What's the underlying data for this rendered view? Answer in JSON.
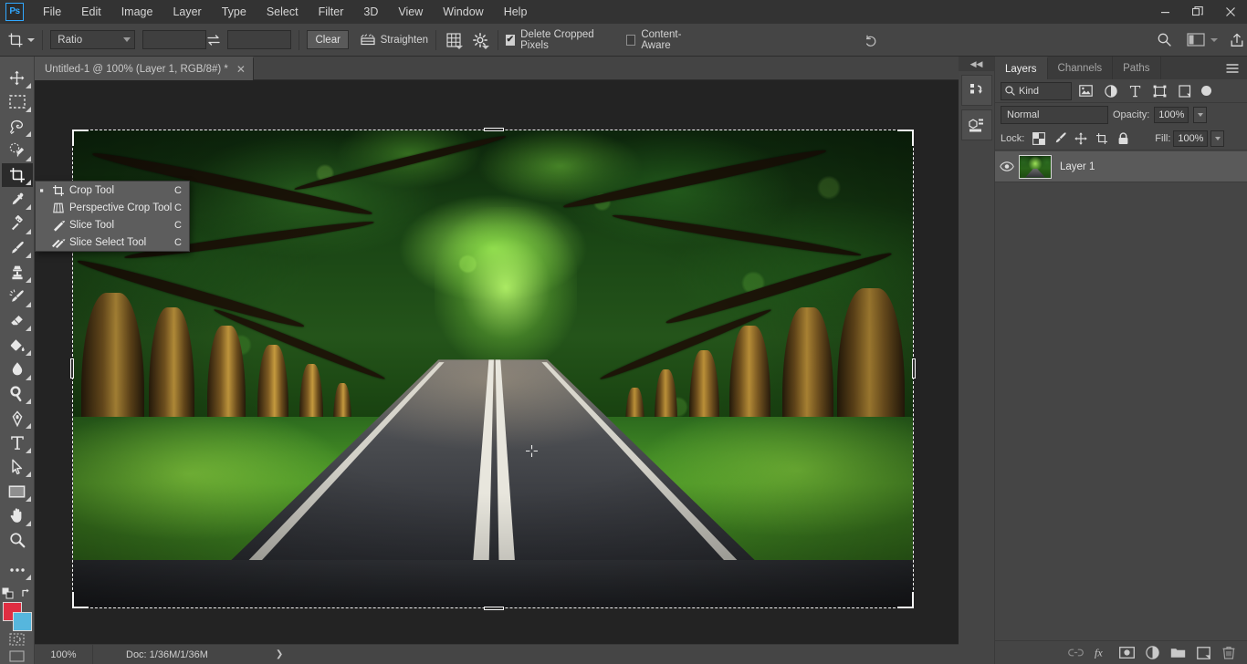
{
  "window": {
    "app_logo": "Ps",
    "minimize_label": "minimize",
    "restore_label": "restore",
    "close_label": "close"
  },
  "menubar": {
    "items": [
      {
        "label": "File"
      },
      {
        "label": "Edit"
      },
      {
        "label": "Image"
      },
      {
        "label": "Layer"
      },
      {
        "label": "Type"
      },
      {
        "label": "Select"
      },
      {
        "label": "Filter"
      },
      {
        "label": "3D"
      },
      {
        "label": "View"
      },
      {
        "label": "Window"
      },
      {
        "label": "Help"
      }
    ]
  },
  "options_bar": {
    "tool_icon": "crop-tool-icon",
    "ratio_select": "Ratio",
    "width_value": "",
    "width_placeholder": "",
    "height_value": "",
    "height_placeholder": "",
    "swap_icon": "swap-arrows-icon",
    "clear_label": "Clear",
    "straighten_icon": "straighten-icon",
    "straighten_label": "Straighten",
    "overlay_icon": "grid-overlay-icon",
    "settings_icon": "gear-icon",
    "delete_cropped_label": "Delete Cropped Pixels",
    "delete_cropped_checked": "✔",
    "content_aware_label": "Content-Aware",
    "reset_icon": "reset-arrow-icon",
    "search_icon": "search-icon",
    "workspace_icon": "screen-mode-icon",
    "share_icon": "share-upload-icon"
  },
  "toolbar": {
    "tools": [
      {
        "name": "move-tool",
        "icon": "move-icon",
        "active": false,
        "has_flyout": true
      },
      {
        "name": "rectangular-marquee-tool",
        "icon": "marquee-icon",
        "active": false,
        "has_flyout": true
      },
      {
        "name": "lasso-tool",
        "icon": "lasso-icon",
        "active": false,
        "has_flyout": true
      },
      {
        "name": "quick-selection-tool",
        "icon": "quick-select-icon",
        "active": false,
        "has_flyout": true
      },
      {
        "name": "crop-tool",
        "icon": "crop-icon",
        "active": true,
        "has_flyout": true
      },
      {
        "name": "eyedropper-tool",
        "icon": "eyedropper-icon",
        "active": false,
        "has_flyout": true
      },
      {
        "name": "spot-healing-brush-tool",
        "icon": "healing-brush-icon",
        "active": false,
        "has_flyout": true
      },
      {
        "name": "brush-tool",
        "icon": "brush-icon",
        "active": false,
        "has_flyout": true
      },
      {
        "name": "clone-stamp-tool",
        "icon": "clone-stamp-icon",
        "active": false,
        "has_flyout": true
      },
      {
        "name": "history-brush-tool",
        "icon": "history-brush-icon",
        "active": false,
        "has_flyout": true
      },
      {
        "name": "eraser-tool",
        "icon": "eraser-icon",
        "active": false,
        "has_flyout": true
      },
      {
        "name": "gradient-tool",
        "icon": "paint-bucket-icon",
        "active": false,
        "has_flyout": true
      },
      {
        "name": "blur-tool",
        "icon": "blur-droplet-icon",
        "active": false,
        "has_flyout": true
      },
      {
        "name": "dodge-tool",
        "icon": "dodge-icon",
        "active": false,
        "has_flyout": true
      },
      {
        "name": "pen-tool",
        "icon": "pen-icon",
        "active": false,
        "has_flyout": true
      },
      {
        "name": "type-tool",
        "icon": "type-t-icon",
        "active": false,
        "has_flyout": true
      },
      {
        "name": "path-selection-tool",
        "icon": "path-arrow-icon",
        "active": false,
        "has_flyout": true
      },
      {
        "name": "rectangle-tool",
        "icon": "rectangle-shape-icon",
        "active": false,
        "has_flyout": true
      },
      {
        "name": "hand-tool",
        "icon": "hand-icon",
        "active": false,
        "has_flyout": true
      },
      {
        "name": "zoom-tool",
        "icon": "magnifier-icon",
        "active": false,
        "has_flyout": false
      },
      {
        "name": "edit-toolbar",
        "icon": "ellipsis-icon",
        "active": false,
        "has_flyout": true
      }
    ],
    "default_colors_icon": "default-colors-icon",
    "swap_colors_icon": "swap-colors-icon",
    "foreground_color": "#e02e42",
    "background_color": "#56b6dd",
    "quick_mask_icon": "quick-mask-icon",
    "screen_mode_icon": "screen-mode-icon"
  },
  "tool_flyout": {
    "items": [
      {
        "label": "Crop Tool",
        "shortcut": "C",
        "icon": "crop-icon",
        "selected": true
      },
      {
        "label": "Perspective Crop Tool",
        "shortcut": "C",
        "icon": "perspective-crop-icon",
        "selected": false
      },
      {
        "label": "Slice Tool",
        "shortcut": "C",
        "icon": "slice-icon",
        "selected": false
      },
      {
        "label": "Slice Select Tool",
        "shortcut": "C",
        "icon": "slice-select-icon",
        "selected": false
      }
    ]
  },
  "document": {
    "tab_title": "Untitled-1 @ 100% (Layer 1, RGB/8#) *",
    "close_glyph": "✕"
  },
  "canvas": {
    "image_alt": "tree-lined road photograph",
    "crop_overlay": "crop-marquee"
  },
  "dock_rail": {
    "collapse_glyph": "◀◀",
    "buttons": [
      {
        "name": "history-panel-icon",
        "label": "history-panel-icon"
      },
      {
        "name": "properties-panel-icon",
        "label": "properties-panel-icon"
      }
    ]
  },
  "layers_panel": {
    "tabs": [
      {
        "label": "Layers",
        "active": true
      },
      {
        "label": "Channels",
        "active": false
      },
      {
        "label": "Paths",
        "active": false
      }
    ],
    "menu_icon": "panel-menu-icon",
    "filter": {
      "kind_label": "Kind",
      "search_icon": "search-icon",
      "icons": [
        "filter-pixel-icon",
        "filter-adjustment-icon",
        "filter-type-icon",
        "filter-shape-icon",
        "filter-smart-object-icon"
      ],
      "toggle_icon": "filter-toggle-icon"
    },
    "blend": {
      "mode": "Normal",
      "opacity_label": "Opacity:",
      "opacity_value": "100%"
    },
    "lock": {
      "label": "Lock:",
      "icons": [
        "lock-transparent-pixels-icon",
        "lock-image-pixels-icon",
        "lock-position-icon",
        "lock-artboard-icon",
        "lock-all-icon"
      ],
      "fill_label": "Fill:",
      "fill_value": "100%"
    },
    "layers": [
      {
        "name": "Layer 1",
        "visible": true,
        "visibility_icon": "eye-icon",
        "thumbnail": "layer-thumbnail",
        "selected": true
      }
    ],
    "footer_icons": [
      {
        "name": "link-layers-icon",
        "glyph": "link",
        "dim": true
      },
      {
        "name": "layer-style-icon",
        "glyph": "fx",
        "dim": false
      },
      {
        "name": "layer-mask-icon",
        "glyph": "mask",
        "dim": false
      },
      {
        "name": "adjustment-layer-icon",
        "glyph": "adjust",
        "dim": false
      },
      {
        "name": "new-group-icon",
        "glyph": "folder",
        "dim": false
      },
      {
        "name": "new-layer-icon",
        "glyph": "new",
        "dim": false
      },
      {
        "name": "delete-layer-icon",
        "glyph": "trash",
        "dim": false
      }
    ]
  },
  "status_bar": {
    "zoom": "100%",
    "doc_info": "Doc: 1/36M/1/36M",
    "expand_glyph": "❯"
  }
}
